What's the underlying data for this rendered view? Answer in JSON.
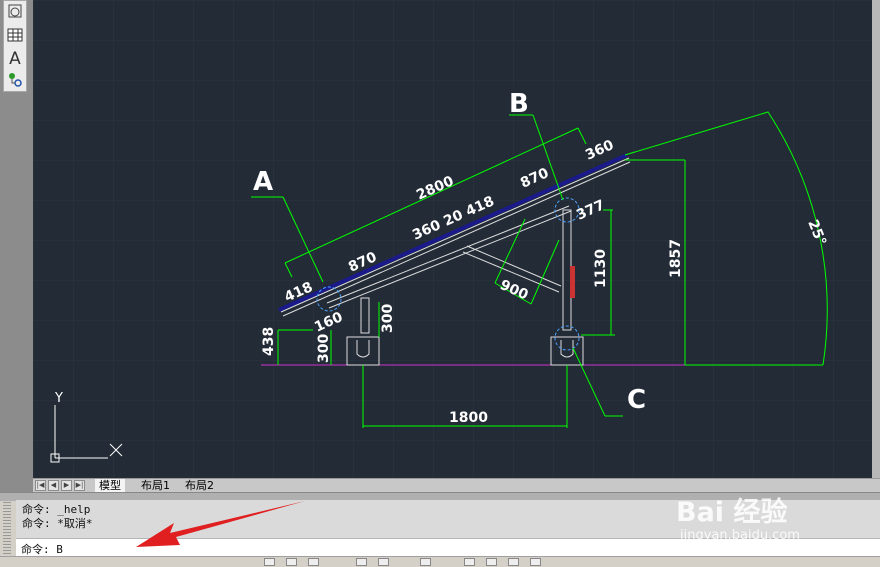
{
  "toolbar": {
    "icons": [
      "circle-tool-icon",
      "table-icon",
      "text-icon",
      "attribute-icon"
    ],
    "text_tool_glyph": "A"
  },
  "drawing": {
    "labels": {
      "a": "A",
      "b": "B",
      "c": "C"
    },
    "dims": {
      "d2800": "2800",
      "d870_top": "870",
      "d360_top": "360",
      "d870_left": "870",
      "d360_20_418": "360 20 418",
      "d418": "418",
      "d160": "160",
      "d377": "377",
      "d900": "900",
      "d1130": "1130",
      "d1857": "1857",
      "d300_inner": "300",
      "d300_outer": "300",
      "d438": "438",
      "d1800": "1800",
      "angle": "25°"
    },
    "ucs": {
      "y": "Y"
    },
    "colors": {
      "background": "#232b36",
      "dimension": "#00ff00",
      "geometry": "#ffffff",
      "panel": "#1a1a8a",
      "ground": "#cc33cc",
      "accent": "#cc3333"
    }
  },
  "layout_tabs": {
    "model": "模型",
    "layout1": "布局1",
    "layout2": "布局2"
  },
  "command": {
    "history": [
      "命令: _help",
      "命令: *取消*"
    ],
    "prompt": "命令: B"
  },
  "watermark": {
    "logo": "Bai 经验",
    "url": "jingyan.baidu.com"
  }
}
